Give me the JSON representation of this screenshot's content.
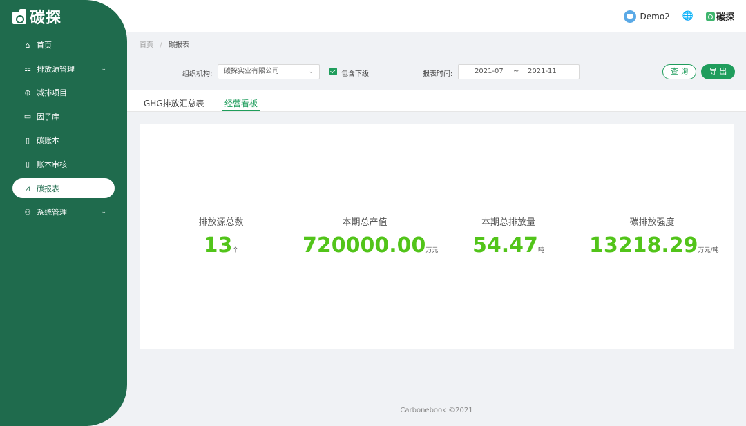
{
  "app": {
    "logo_text": "碳探"
  },
  "sidebar": {
    "items": [
      {
        "label": "首页",
        "icon": "home-icon"
      },
      {
        "label": "排放源管理",
        "icon": "list-icon"
      },
      {
        "label": "减排项目",
        "icon": "globe-icon"
      },
      {
        "label": "因子库",
        "icon": "folder-icon"
      },
      {
        "label": "碳账本",
        "icon": "book-icon"
      },
      {
        "label": "账本审核",
        "icon": "document-icon"
      },
      {
        "label": "碳报表",
        "icon": "chart-icon"
      },
      {
        "label": "系统管理",
        "icon": "users-icon"
      }
    ],
    "active_item": "碳报表"
  },
  "header": {
    "user": "Demo2",
    "brand": "碳探"
  },
  "breadcrumb": {
    "home": "首页",
    "separator": "/",
    "current": "碳报表"
  },
  "filters": {
    "org_label": "组织机构:",
    "org_value": "碳探实业有限公司",
    "include_sub_label": "包含下级",
    "include_sub_checked": true,
    "date_label": "报表时间:",
    "date_start": "2021-07",
    "date_sep": "~",
    "date_end": "2021-11",
    "query_label": "查 询",
    "export_label": "导 出"
  },
  "tabs": [
    {
      "label": "GHG排放汇总表"
    },
    {
      "label": "经营看板"
    }
  ],
  "active_tab": "经营看板",
  "stats": [
    {
      "label": "排放源总数",
      "value": "13",
      "unit": "个"
    },
    {
      "label": "本期总产值",
      "value": "720000.00",
      "unit": "万元"
    },
    {
      "label": "本期总排放量",
      "value": "54.47",
      "unit": "吨"
    },
    {
      "label": "碳排放强度",
      "value": "13218.29",
      "unit": "万元/吨"
    }
  ],
  "colors": {
    "sidebar": "#1f6b4d",
    "accent": "#1f9d5c",
    "value_green": "#52c41a"
  },
  "footer": "Carbonebook ©2021"
}
